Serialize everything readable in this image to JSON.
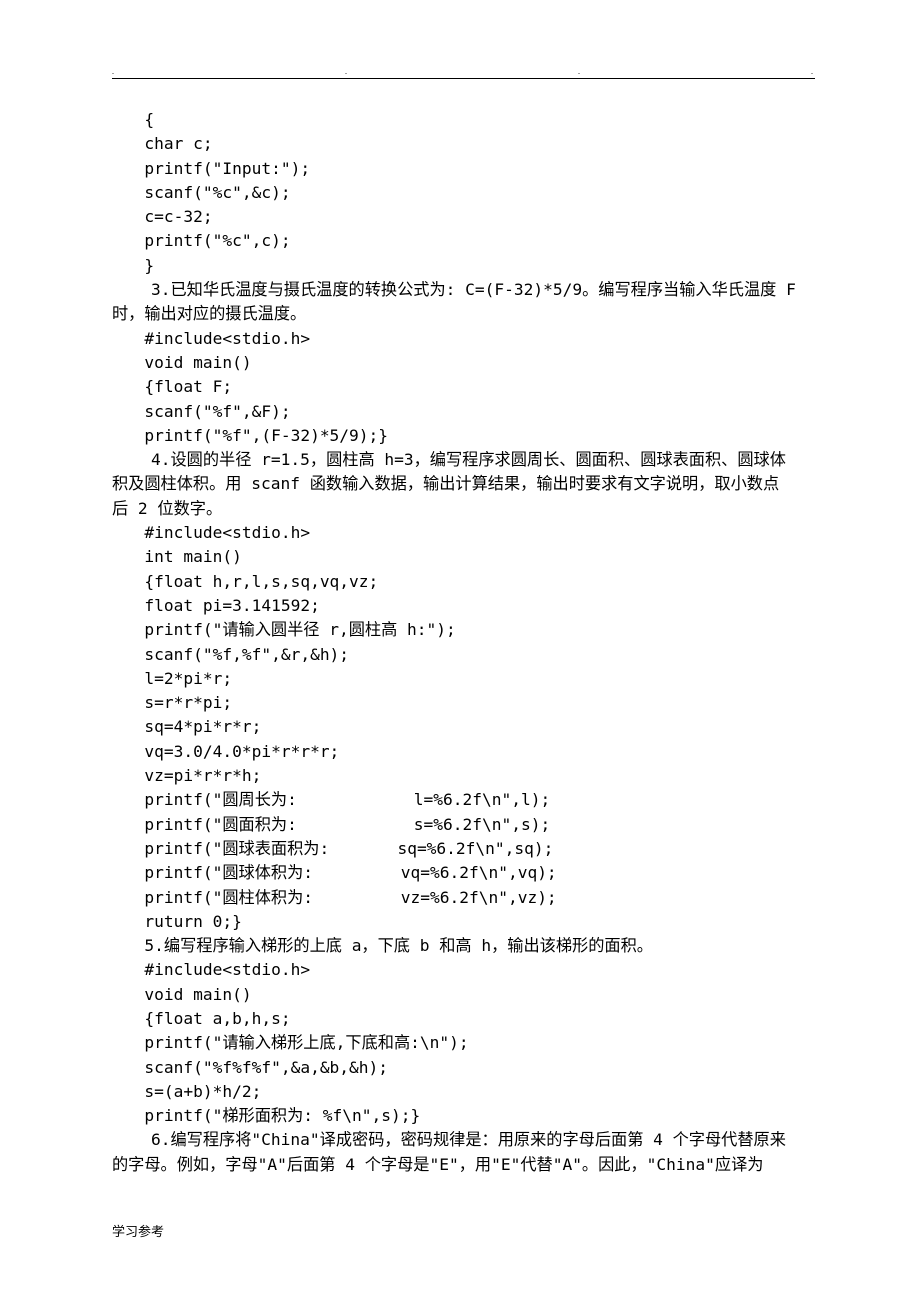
{
  "header": {
    "dot": "."
  },
  "lines": {
    "l01": "{",
    "l02": "char c;",
    "l03": "printf(\"Input:\");",
    "l04": "scanf(\"%c\",&c);",
    "l05": "c=c-32;",
    "l06": "printf(\"%c\",c);",
    "l07": "}",
    "l08": "    3.已知华氏温度与摄氏温度的转换公式为: C=(F-32)*5/9。编写程序当输入华氏温度 F",
    "l09": "时，输出对应的摄氏温度。",
    "l10": "#include<stdio.h>",
    "l11": "void main()",
    "l12": "{float F;",
    "l13": "scanf(\"%f\",&F);",
    "l14": "printf(\"%f\",(F-32)*5/9);}",
    "l15": "    4.设圆的半径 r=1.5，圆柱高 h=3，编写程序求圆周长、圆面积、圆球表面积、圆球体",
    "l16": "积及圆柱体积。用 scanf 函数输入数据，输出计算结果，输出时要求有文字说明，取小数点",
    "l17": "后 2 位数字。",
    "l18": "#include<stdio.h>",
    "l19": "int main()",
    "l20": "{float h,r,l,s,sq,vq,vz;",
    "l21": "float pi=3.141592;",
    "l22": "printf(\"请输入圆半径 r,圆柱高 h:\");",
    "l23": "scanf(\"%f,%f\",&r,&h);",
    "l24": "l=2*pi*r;",
    "l25": "s=r*r*pi;",
    "l26": "sq=4*pi*r*r;",
    "l27": "vq=3.0/4.0*pi*r*r*r;",
    "l28": "vz=pi*r*r*h;",
    "l29": "printf(\"圆周长为:            l=%6.2f\\n\",l);",
    "l30": "printf(\"圆面积为:            s=%6.2f\\n\",s);",
    "l31": "printf(\"圆球表面积为:       sq=%6.2f\\n\",sq);",
    "l32": "printf(\"圆球体积为:         vq=%6.2f\\n\",vq);",
    "l33": "printf(\"圆柱体积为:         vz=%6.2f\\n\",vz);",
    "l34": "ruturn 0;}",
    "l35": "5.编写程序输入梯形的上底 a，下底 b 和高 h，输出该梯形的面积。",
    "l36": "#include<stdio.h>",
    "l37": "void main()",
    "l38": "{float a,b,h,s;",
    "l39": "printf(\"请输入梯形上底,下底和高:\\n\");",
    "l40": "scanf(\"%f%f%f\",&a,&b,&h);",
    "l41": "s=(a+b)*h/2;",
    "l42": "printf(\"梯形面积为: %f\\n\",s);}",
    "l43": "    6.编写程序将\"China\"译成密码，密码规律是：用原来的字母后面第 4 个字母代替原来",
    "l44": "的字母。例如，字母\"A\"后面第 4 个字母是\"E\"，用\"E\"代替\"A\"。因此，\"China\"应译为"
  },
  "footer": "学习参考"
}
